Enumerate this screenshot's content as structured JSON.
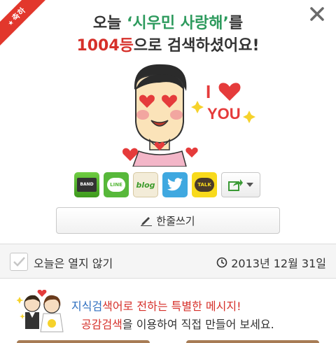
{
  "ribbon": {
    "label": "축하",
    "star": "★"
  },
  "headline": {
    "line1_prefix": "오늘 ",
    "term": "‘시우민 사랑해’",
    "line1_suffix": "를",
    "rank": "1004등",
    "line2_suffix": "으로 검색하셨어요!"
  },
  "sticker": {
    "text_i": "I",
    "text_you": "YOU"
  },
  "share": {
    "band_label": "BAND",
    "line_label": "LINE",
    "blog_label": "blog",
    "talk_label": "TALK"
  },
  "comment_button": {
    "label": "한줄쓰기"
  },
  "options": {
    "checkbox_label": "오늘은 열지 않기",
    "date": "2013년 12월 31일"
  },
  "promo": {
    "line1_strike": "지식검",
    "line1_text": "색어로 전하는 특별한 메시지!",
    "line2_highlight": "공감검색",
    "line2_text": "을 이용하여 직접 만들어 보세요."
  },
  "colors": {
    "accent_red": "#d6302a",
    "accent_green": "#2d9a5d",
    "ribbon": "#e2372c"
  }
}
